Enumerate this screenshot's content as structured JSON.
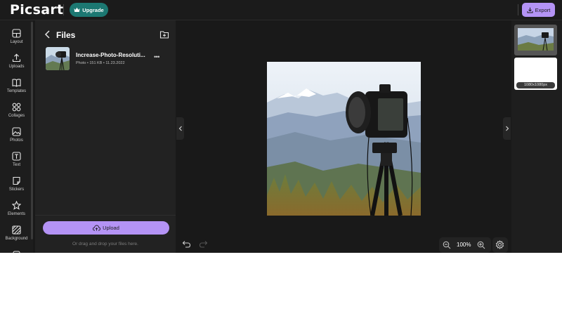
{
  "header": {
    "logo_text": "Picsart",
    "upgrade_label": "Upgrade",
    "export_label": "Export",
    "accent_color": "#b493f5",
    "upgrade_color": "#1c7872"
  },
  "sidebar": {
    "items": [
      {
        "label": "Layout",
        "icon": "layout-icon"
      },
      {
        "label": "Uploads",
        "icon": "upload-icon"
      },
      {
        "label": "Templates",
        "icon": "book-icon"
      },
      {
        "label": "Collages",
        "icon": "grid-icon"
      },
      {
        "label": "Photos",
        "icon": "image-icon"
      },
      {
        "label": "Text",
        "icon": "text-icon"
      },
      {
        "label": "Stickers",
        "icon": "sticker-icon"
      },
      {
        "label": "Elements",
        "icon": "star-icon"
      },
      {
        "label": "Background",
        "icon": "pattern-icon"
      }
    ]
  },
  "files_panel": {
    "title": "Files",
    "files": [
      {
        "name": "Increase-Photo-Resoluti...",
        "meta": "Photo • 151 KB • 11.23.2022"
      }
    ],
    "upload_label": "Upload",
    "drop_hint": "Or drag and drop your files here."
  },
  "canvas": {
    "zoom": "100%"
  },
  "pages_panel": {
    "page_size": "1080x1080px"
  }
}
